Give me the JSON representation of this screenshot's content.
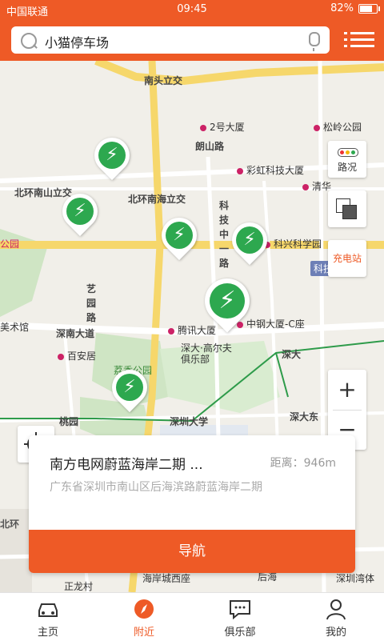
{
  "status_bar": {
    "carrier": "中国联通",
    "time": "09:45",
    "battery": "82%",
    "battery_level": 0.82
  },
  "search": {
    "value": "小猫停车场"
  },
  "map": {
    "labels": [
      "南头立交",
      "北环南山立交",
      "北环南海立交",
      "朗山路",
      "2号大厦",
      "松岭公园",
      "彩虹科技大厦",
      "清华",
      "科技中一路",
      "科兴科学园",
      "科技园",
      "艺园路",
      "深南大道",
      "腾讯大厦",
      "中钢大厦-C座",
      "深大·高尔夫俱乐部",
      "深大",
      "百安居",
      "荔香公园",
      "深圳大学",
      "桃园",
      "深大东",
      "科技",
      "海岸城西座",
      "后海",
      "深圳湾体",
      "公园",
      "北环",
      "正龙村",
      "美术馆"
    ],
    "controls": {
      "traffic_label": "路况",
      "charge_label": "充电站",
      "zoom_in": "+",
      "zoom_out": "−"
    },
    "pin_icon": "charging-bolt-icon"
  },
  "station_card": {
    "title": "南方电网蔚蓝海岸二期 ...",
    "distance": "距离：946m",
    "address": "广东省深圳市南山区后海滨路蔚蓝海岸二期",
    "nav_label": "导航"
  },
  "tabs": [
    {
      "label": "主页",
      "icon": "car-icon"
    },
    {
      "label": "附近",
      "icon": "compass-icon"
    },
    {
      "label": "俱乐部",
      "icon": "chat-icon"
    },
    {
      "label": "我的",
      "icon": "user-icon"
    }
  ],
  "colors": {
    "brand": "#ee5a26",
    "charger_green": "#2da84f",
    "road_yellow": "#f6d76b",
    "metro_green": "#2e9b4a"
  }
}
